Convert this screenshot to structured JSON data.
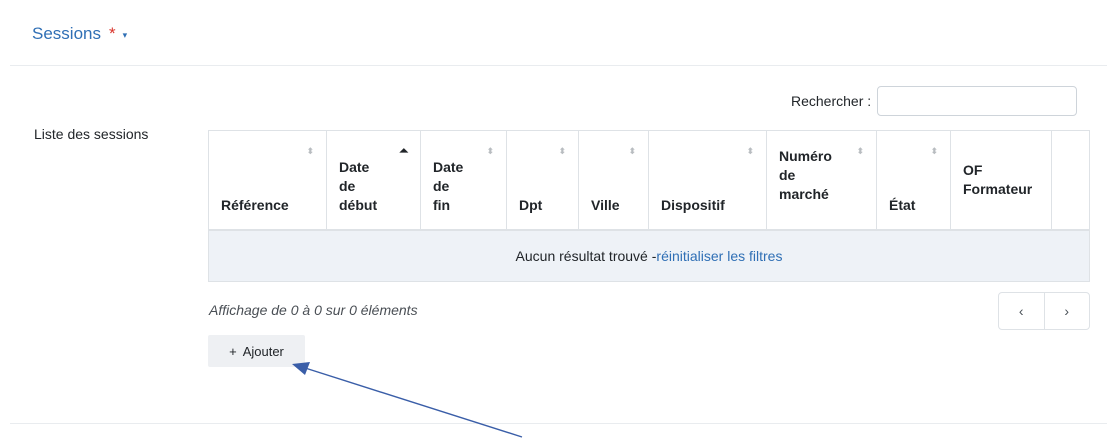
{
  "section": {
    "title": "Sessions",
    "required_mark": "*",
    "caret": "▾"
  },
  "field_label": "Liste des sessions",
  "search": {
    "label": "Rechercher :",
    "value": "",
    "placeholder": ""
  },
  "table": {
    "columns": [
      {
        "label": "Référence",
        "sort": "none"
      },
      {
        "label": "Date\nde\ndébut",
        "sort": "asc"
      },
      {
        "label": "Date\nde\nfin",
        "sort": "none"
      },
      {
        "label": "Dpt",
        "sort": "none"
      },
      {
        "label": "Ville",
        "sort": "none"
      },
      {
        "label": "Dispositif",
        "sort": "none"
      },
      {
        "label": "Numéro\nde\nmarché",
        "sort": "none"
      },
      {
        "label": "État",
        "sort": "none"
      },
      {
        "label": "OF\nFormateur",
        "sort": "unsortable"
      },
      {
        "label": "",
        "sort": "unsortable"
      }
    ],
    "empty_text": "Aucun résultat trouvé - ",
    "reset_link": "réinitialiser les filtres"
  },
  "info_text": "Affichage de 0 à 0 sur 0 éléments",
  "pagination": {
    "prev": "‹",
    "next": "›"
  },
  "add_button": {
    "icon": "+",
    "label": "Ajouter"
  },
  "icons": {
    "sort_none": "⬍",
    "sort_asc": "⏶"
  },
  "colors": {
    "link_blue": "#2f6fb5",
    "required_red": "#d9342b",
    "empty_row_bg": "#eef2f7",
    "annotation_arrow": "#3a5ea8"
  }
}
